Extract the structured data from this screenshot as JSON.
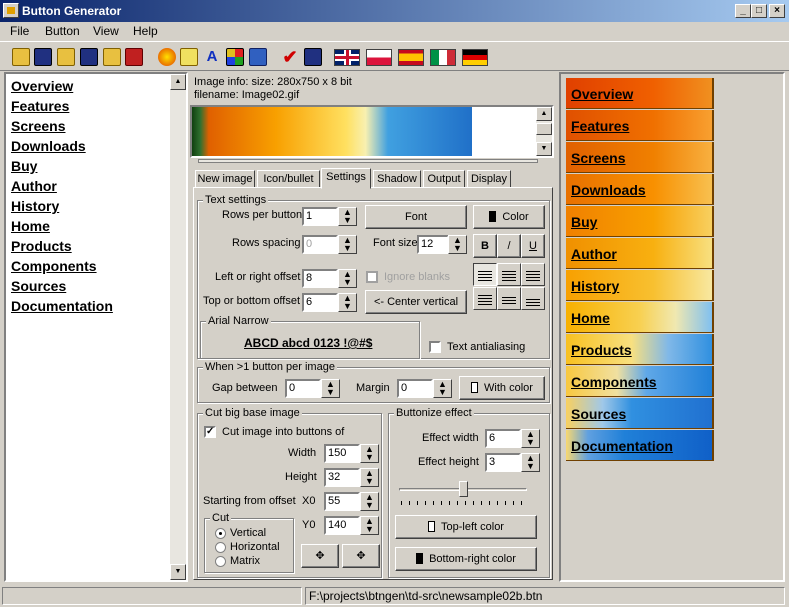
{
  "app": {
    "title": "Button Generator"
  },
  "menu": [
    "File",
    "Button",
    "View",
    "Help"
  ],
  "toolbar_icons": [
    "open-folder-icon",
    "save-icon",
    "open-icon",
    "save-as-icon",
    "open-project-icon",
    "save-project-icon",
    "generate-icon",
    "copy-icon",
    "font-icon",
    "grid-icon",
    "layers-icon",
    "check-icon",
    "export-icon"
  ],
  "flags": [
    "english-flag-icon",
    "polish-flag-icon",
    "spanish-flag-icon",
    "italian-flag-icon",
    "german-flag-icon"
  ],
  "nav": {
    "items": [
      "Overview",
      "Features",
      "Screens",
      "Downloads",
      "Buy",
      "Author",
      "History",
      "Home",
      "Products",
      "Components",
      "Sources",
      "Documentation"
    ]
  },
  "image_info": {
    "size": "Image info: size: 280x750 x 8 bit",
    "filename": "filename: Image02.gif"
  },
  "tabs": [
    "New image",
    "Icon/bullet",
    "Settings",
    "Shadow",
    "Output",
    "Display"
  ],
  "active_tab": "Settings",
  "text_settings": {
    "legend": "Text settings",
    "rows_per_button_label": "Rows per button",
    "rows_per_button": "1",
    "rows_spacing_label": "Rows spacing",
    "rows_spacing": "0",
    "left_right_offset_label": "Left or right offset",
    "left_right_offset": "8",
    "top_bottom_offset_label": "Top or bottom offset",
    "top_bottom_offset": "6",
    "font_button": "Font",
    "color_button": "Color",
    "font_size_label": "Font size",
    "font_size": "12",
    "bold": "B",
    "italic": "/",
    "underline": "U",
    "ignore_blanks": "Ignore blanks",
    "center_vertical": "<- Center vertical",
    "font_name": "Arial Narrow",
    "font_sample": "ABCD abcd 0123 !@#$",
    "text_antialiasing": "Text antialiasing"
  },
  "multi_button": {
    "legend": "When >1 button per image",
    "gap_label": "Gap between",
    "gap": "0",
    "margin_label": "Margin",
    "margin": "0",
    "with_color": "With color"
  },
  "cut": {
    "legend": "Cut big base image",
    "cut_into_buttons": "Cut image into buttons of",
    "width_label": "Width",
    "width": "150",
    "height_label": "Height",
    "height": "32",
    "starting_label": "Starting from offset",
    "x0_label": "X0",
    "x0": "55",
    "y0_label": "Y0",
    "y0": "140",
    "cut_legend": "Cut",
    "options": [
      "Vertical",
      "Horizontal",
      "Matrix"
    ],
    "selected": "Vertical"
  },
  "buttonize": {
    "legend": "Buttonize effect",
    "effect_width_label": "Effect width",
    "effect_width": "6",
    "effect_height_label": "Effect height",
    "effect_height": "3",
    "slider_level": 0.5,
    "top_left_color": "Top-left color",
    "bottom_right_color": "Bottom-right color"
  },
  "preview_buttons": [
    "Overview",
    "Features",
    "Screens",
    "Downloads",
    "Buy",
    "Author",
    "History",
    "Home",
    "Products",
    "Components",
    "Sources",
    "Documentation"
  ],
  "status": {
    "path": "F:\\projects\\btngen\\td-src\\newsample02b.btn"
  }
}
